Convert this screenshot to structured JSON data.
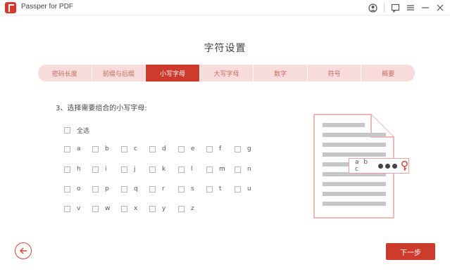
{
  "window": {
    "title": "Passper for PDF"
  },
  "heading": "字符设置",
  "tabs": [
    {
      "label": "密码长度",
      "active": false
    },
    {
      "label": "前缀与后缀",
      "active": false
    },
    {
      "label": "小写字母",
      "active": true
    },
    {
      "label": "大写字母",
      "active": false
    },
    {
      "label": "数字",
      "active": false
    },
    {
      "label": "符号",
      "active": false
    },
    {
      "label": "概要",
      "active": false
    }
  ],
  "section_label": "3、选择需要组合的小写字母:",
  "select_all_label": "全选",
  "letters": [
    "a",
    "b",
    "c",
    "d",
    "e",
    "f",
    "g",
    "h",
    "i",
    "j",
    "k",
    "l",
    "m",
    "n",
    "o",
    "p",
    "q",
    "r",
    "s",
    "t",
    "u",
    "v",
    "w",
    "x",
    "y",
    "z"
  ],
  "illustration": {
    "badge_text": "a b c"
  },
  "buttons": {
    "next": "下一步"
  },
  "colors": {
    "accent": "#cc3b2c",
    "tab_bg": "#f8dcdc"
  },
  "icons": [
    "app-icon",
    "user-icon",
    "feedback-icon",
    "menu-icon",
    "minimize-icon",
    "close-icon",
    "back-arrow-icon",
    "key-icon"
  ]
}
